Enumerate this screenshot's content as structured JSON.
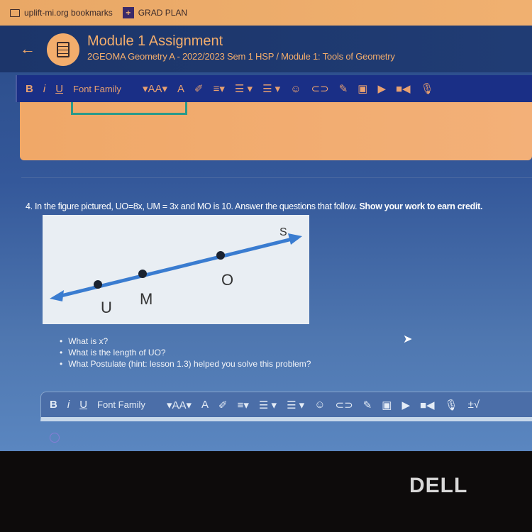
{
  "bookmarks": [
    {
      "label": "uplift-mi.org bookmarks",
      "icon": "folder-icon"
    },
    {
      "label": "GRAD PLAN",
      "icon": "grad-plan-icon"
    }
  ],
  "header": {
    "title": "Module 1 Assignment",
    "breadcrumb": "2GEOMA Geometry A - 2022/2023 Sem 1 HSP / Module 1: Tools of Geometry",
    "back": "←"
  },
  "toolbar": {
    "bold": "B",
    "italic": "i",
    "underline": "U",
    "font_family": "Font Family",
    "font_size": "▾AA▾",
    "text_color": "A",
    "highlight": "✐",
    "align": "≡▾",
    "ordered_list": "☰ ▾",
    "unordered_list": "☰ ▾",
    "emoji": "☺",
    "link": "⊂⊃",
    "pencil": "✎",
    "image": "▣",
    "video": "▶",
    "camera": "■◀",
    "mic": "🎙",
    "math": "±√"
  },
  "question": {
    "text": "4. In the figure pictured, UO=8x, UM = 3x and MO is 10. Answer the questions that follow.",
    "emphasis": "Show your work to earn credit."
  },
  "figure": {
    "points": [
      "U",
      "M",
      "O"
    ],
    "ray_label": "S",
    "line_color": "#3a7cd0"
  },
  "bullets": [
    "What is x?",
    "What is the length of UO?",
    "What Postulate (hint: lesson 1.3) helped you solve this problem?"
  ],
  "brand": "DELL"
}
